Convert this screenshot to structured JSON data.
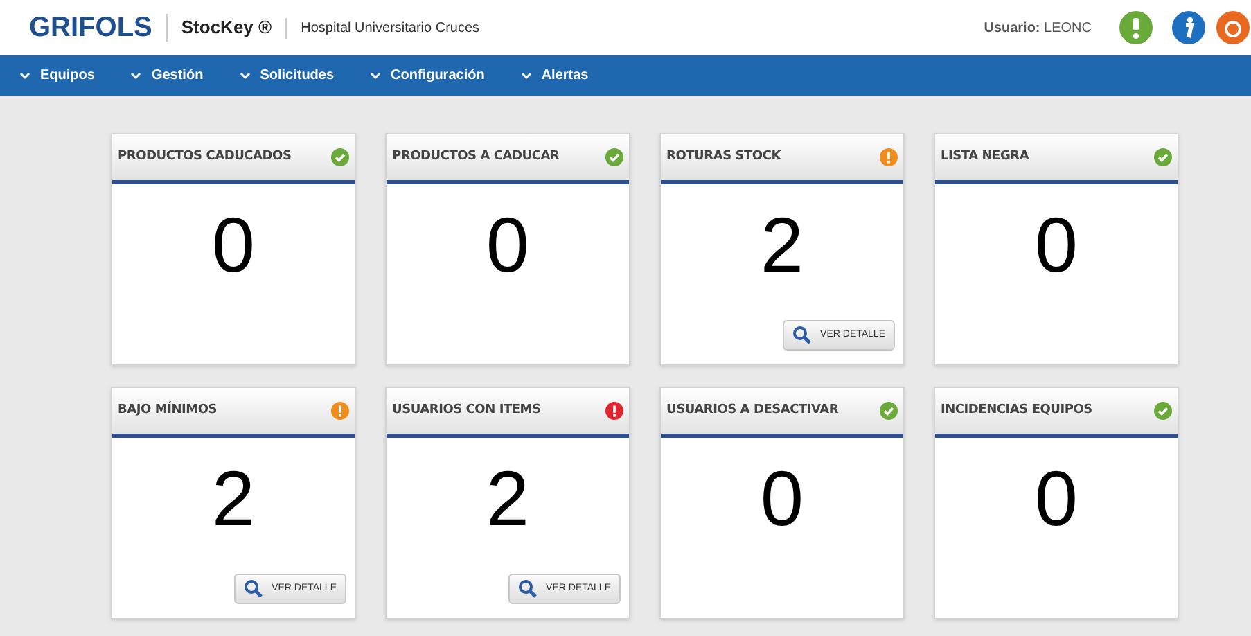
{
  "header": {
    "brand": "GRIFOLS",
    "product": "StocKey ®",
    "hospital": "Hospital Universitario Cruces",
    "user_label": "Usuario:",
    "user_name": "LEONC"
  },
  "nav": [
    {
      "label": "Equipos"
    },
    {
      "label": "Gestión"
    },
    {
      "label": "Solicitudes"
    },
    {
      "label": "Configuración"
    },
    {
      "label": "Alertas"
    }
  ],
  "cards": [
    {
      "title": "PRODUCTOS CADUCADOS",
      "kind": "check",
      "color": "#6aaa3a",
      "value": "0"
    },
    {
      "title": "PRODUCTOS A CADUCAR",
      "kind": "check",
      "color": "#6aaa3a",
      "value": "0"
    },
    {
      "title": "ROTURAS STOCK",
      "kind": "exclamation",
      "color": "#f08c1c",
      "value": "2",
      "button": "VER DETALLE"
    },
    {
      "title": "LISTA NEGRA",
      "kind": "check",
      "color": "#6aaa3a",
      "value": "0"
    },
    {
      "title": "BAJO MÍNIMOS",
      "kind": "exclamation",
      "color": "#f08c1c",
      "value": "2",
      "button": "VER DETALLE"
    },
    {
      "title": "USUARIOS CON ITEMS",
      "kind": "exclamation",
      "color": "#e0262f",
      "value": "2",
      "button": "VER DETALLE"
    },
    {
      "title": "USUARIOS A DESACTIVAR",
      "kind": "check",
      "color": "#6aaa3a",
      "value": "0"
    },
    {
      "title": "INCIDENCIAS EQUIPOS",
      "kind": "check",
      "color": "#6aaa3a",
      "value": "0"
    }
  ]
}
